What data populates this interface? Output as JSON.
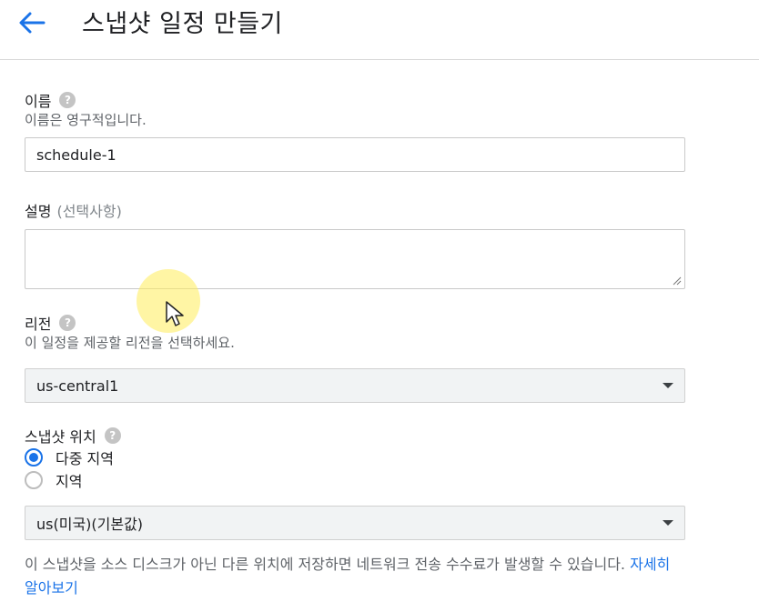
{
  "header": {
    "back_icon": "arrow-left-icon",
    "title": "스냅샷 일정 만들기"
  },
  "form": {
    "name": {
      "label": "이름",
      "help_icon": "help-icon",
      "help_glyph": "?",
      "hint": "이름은 영구적입니다.",
      "value": "schedule-1"
    },
    "description": {
      "label": "설명",
      "optional": "(선택사항)",
      "value": ""
    },
    "region": {
      "label": "리전",
      "help_glyph": "?",
      "hint": "이 일정을 제공할 리전을 선택하세요.",
      "selected": "us-central1"
    },
    "snapshot_location": {
      "label": "스냅샷 위치",
      "help_glyph": "?",
      "options": [
        {
          "label": "다중 지역",
          "checked": true
        },
        {
          "label": "지역",
          "checked": false
        }
      ],
      "selected": "us(미국)(기본값)"
    },
    "note": {
      "text": "이 스냅샷을 소스 디스크가 아닌 다른 위치에 저장하면 네트워크 전송 수수료가 발생할 수 있습니다.",
      "link": "자세히 알아보기"
    }
  },
  "colors": {
    "accent": "#1a73e8",
    "help_icon": "#c4c4c4",
    "select_bg": "#f1f3f4"
  }
}
